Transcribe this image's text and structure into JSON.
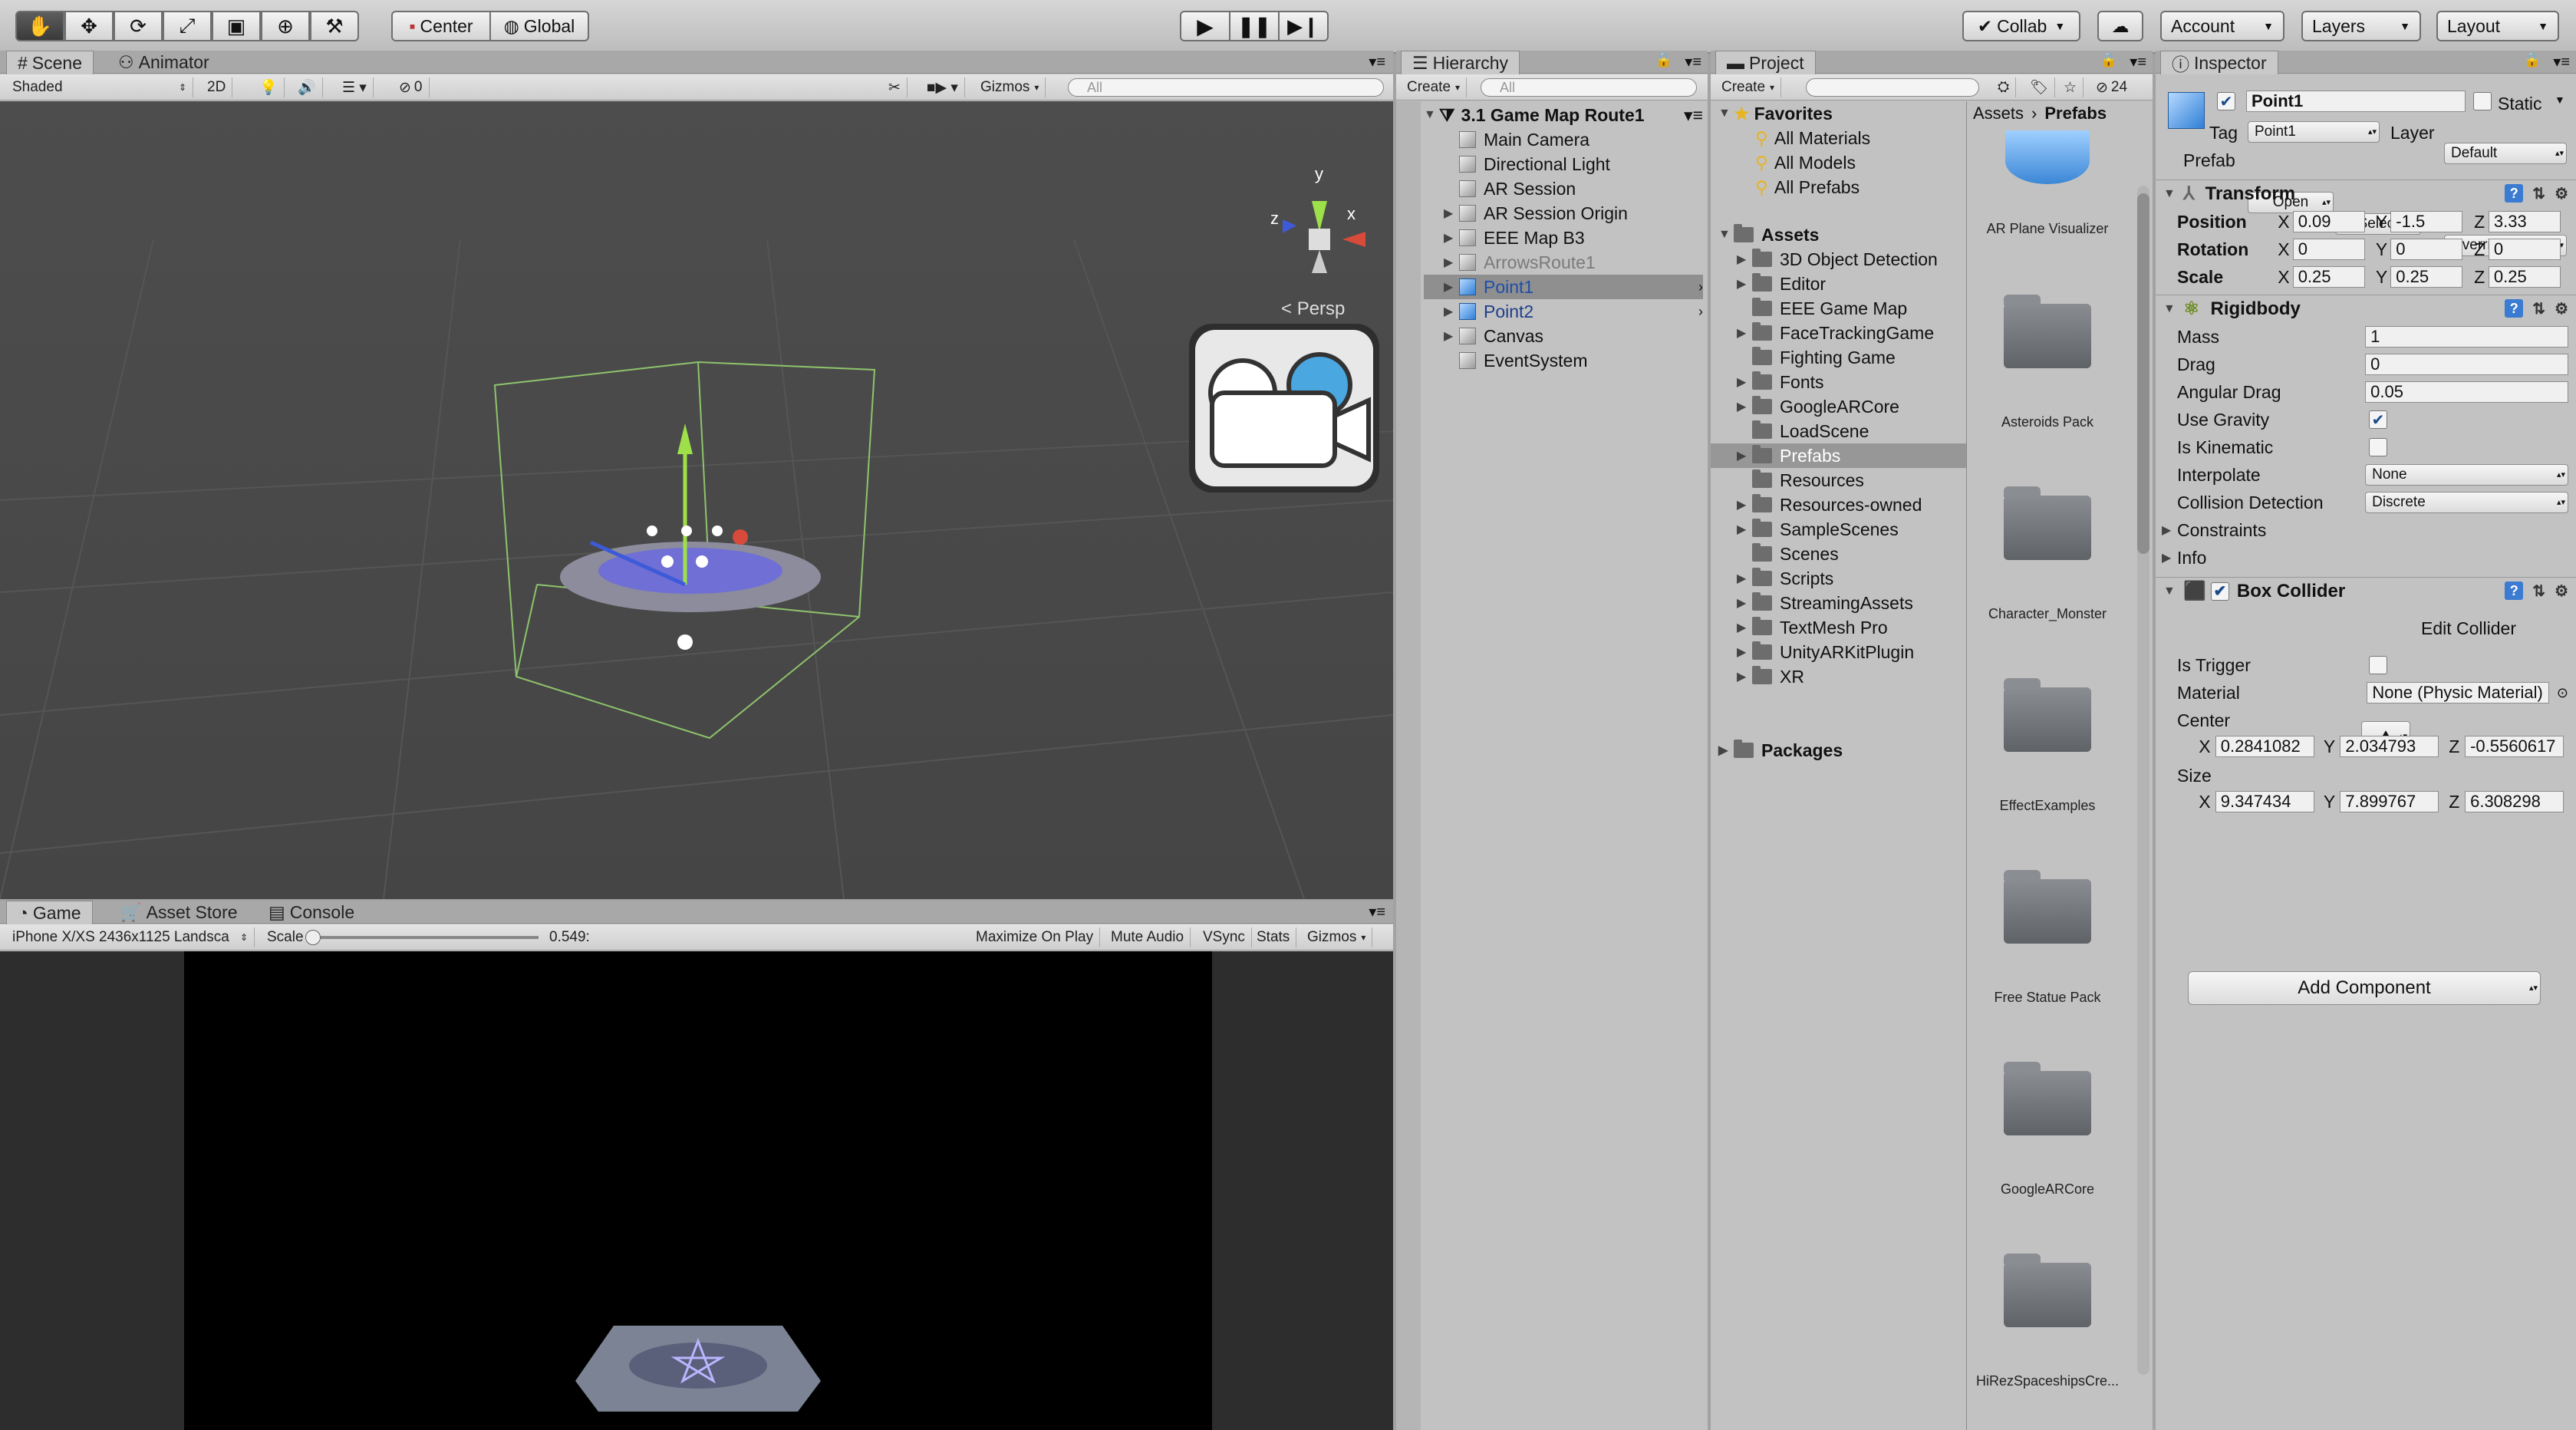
{
  "toolbar": {
    "pivot": "Center",
    "space": "Global",
    "collab": "Collab",
    "account": "Account",
    "layers": "Layers",
    "layout": "Layout",
    "tools": [
      "hand-tool",
      "move-tool",
      "rotate-tool",
      "scale-tool",
      "rect-tool",
      "transform-tool",
      "custom-tool"
    ]
  },
  "scene": {
    "tabs": [
      "Scene",
      "Animator"
    ],
    "shading": "Shaded",
    "mode2d": "2D",
    "hidden_count": "0",
    "gizmos": "Gizmos",
    "search_placeholder": "All",
    "persp": "Persp",
    "axis_x": "x",
    "axis_y": "y",
    "axis_z": "z"
  },
  "game": {
    "tabs": [
      "Game",
      "Asset Store",
      "Console"
    ],
    "resolution": "iPhone X/XS 2436x1125 Landsca",
    "scale_label": "Scale",
    "scale_value": "0.549:",
    "scale_fraction": 0.549,
    "buttons": [
      "Maximize On Play",
      "Mute Audio",
      "VSync",
      "Stats",
      "Gizmos"
    ]
  },
  "hierarchy": {
    "tab": "Hierarchy",
    "create": "Create",
    "search_placeholder": "All",
    "scene_name": "3.1 Game Map Route1",
    "items": [
      {
        "label": "Main Camera",
        "arrow": false,
        "style": "normal"
      },
      {
        "label": "Directional Light",
        "arrow": false,
        "style": "normal"
      },
      {
        "label": "AR Session",
        "arrow": false,
        "style": "normal"
      },
      {
        "label": "AR Session Origin",
        "arrow": true,
        "style": "normal"
      },
      {
        "label": "EEE Map B3",
        "arrow": true,
        "style": "normal"
      },
      {
        "label": "ArrowsRoute1",
        "arrow": true,
        "style": "inactive"
      },
      {
        "label": "Point1",
        "arrow": true,
        "style": "selected"
      },
      {
        "label": "Point2",
        "arrow": true,
        "style": "prefab"
      },
      {
        "label": "Canvas",
        "arrow": true,
        "style": "normal"
      },
      {
        "label": "EventSystem",
        "arrow": false,
        "style": "normal"
      }
    ]
  },
  "project": {
    "tab": "Project",
    "create": "Create",
    "hidden_count": "24",
    "breadcrumb": [
      "Assets",
      "Prefabs"
    ],
    "favorites_label": "Favorites",
    "favorites": [
      "All Materials",
      "All Models",
      "All Prefabs"
    ],
    "assets_label": "Assets",
    "folders": [
      {
        "label": "3D Object Detection",
        "arrow": true
      },
      {
        "label": "Editor",
        "arrow": true
      },
      {
        "label": "EEE Game Map",
        "arrow": false
      },
      {
        "label": "FaceTrackingGame",
        "arrow": true
      },
      {
        "label": "Fighting Game",
        "arrow": false
      },
      {
        "label": "Fonts",
        "arrow": true
      },
      {
        "label": "GoogleARCore",
        "arrow": true
      },
      {
        "label": "LoadScene",
        "arrow": false
      },
      {
        "label": "Prefabs",
        "arrow": true
      },
      {
        "label": "Resources",
        "arrow": false
      },
      {
        "label": "Resources-owned",
        "arrow": true
      },
      {
        "label": "SampleScenes",
        "arrow": true
      },
      {
        "label": "Scenes",
        "arrow": false
      },
      {
        "label": "Scripts",
        "arrow": true
      },
      {
        "label": "StreamingAssets",
        "arrow": true
      },
      {
        "label": "TextMesh Pro",
        "arrow": true
      },
      {
        "label": "UnityARKitPlugin",
        "arrow": true
      },
      {
        "label": "XR",
        "arrow": true
      }
    ],
    "packages_label": "Packages",
    "tiles": [
      "AR Plane Visualizer",
      "Asteroids Pack",
      "Character_Monster",
      "EffectExamples",
      "Free Statue Pack",
      "GoogleARCore",
      "HiRezSpaceshipsCre..."
    ]
  },
  "inspector": {
    "tab": "Inspector",
    "object_name": "Point1",
    "static_label": "Static",
    "tag_label": "Tag",
    "tag_value": "Point1",
    "layer_label": "Layer",
    "layer_value": "Default",
    "prefab_label": "Prefab",
    "prefab_open": "Open",
    "prefab_select": "Select",
    "prefab_overrides": "Overrides",
    "transform": {
      "title": "Transform",
      "position": {
        "label": "Position",
        "x": "0.09",
        "y": "-1.5",
        "z": "3.33"
      },
      "rotation": {
        "label": "Rotation",
        "x": "0",
        "y": "0",
        "z": "0"
      },
      "scale": {
        "label": "Scale",
        "x": "0.25",
        "y": "0.25",
        "z": "0.25"
      }
    },
    "rigidbody": {
      "title": "Rigidbody",
      "mass_label": "Mass",
      "mass": "1",
      "drag_label": "Drag",
      "drag": "0",
      "angular_label": "Angular Drag",
      "angular": "0.05",
      "gravity_label": "Use Gravity",
      "gravity": true,
      "kinematic_label": "Is Kinematic",
      "kinematic": false,
      "interpolate_label": "Interpolate",
      "interpolate": "None",
      "collision_label": "Collision Detection",
      "collision": "Discrete",
      "constraints_label": "Constraints",
      "info_label": "Info"
    },
    "box_collider": {
      "title": "Box Collider",
      "edit_label": "Edit Collider",
      "trigger_label": "Is Trigger",
      "trigger": false,
      "material_label": "Material",
      "material": "None (Physic Material)",
      "center_label": "Center",
      "center": {
        "x": "0.2841082",
        "y": "2.034793",
        "z": "-0.5560617"
      },
      "size_label": "Size",
      "size": {
        "x": "9.347434",
        "y": "7.899767",
        "z": "6.308298"
      }
    },
    "add_component": "Add Component",
    "axis": {
      "x": "X",
      "y": "Y",
      "z": "Z"
    }
  }
}
